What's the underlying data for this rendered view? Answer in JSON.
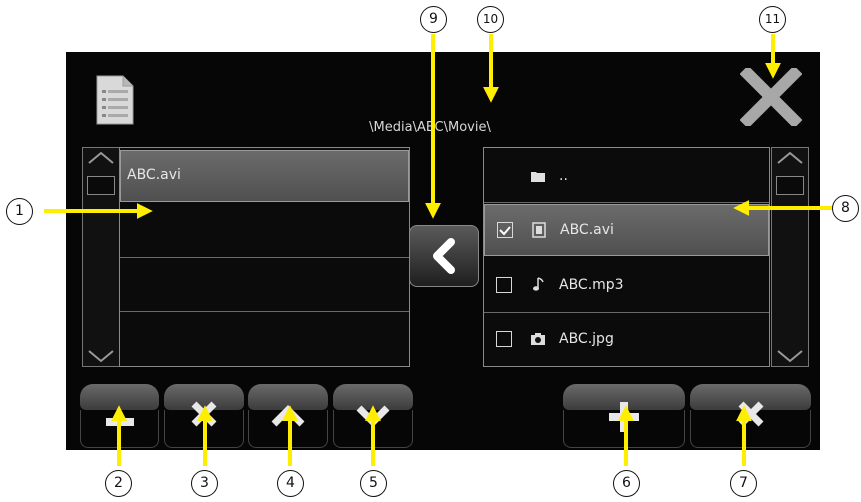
{
  "path": "\\Media\\ABC\\Movie\\",
  "playlist": {
    "items": [
      "ABC.avi",
      "",
      "",
      ""
    ]
  },
  "browser": {
    "items": [
      {
        "name": "..",
        "type": "folder",
        "checked": null
      },
      {
        "name": "ABC.avi",
        "type": "video",
        "checked": true
      },
      {
        "name": "ABC.mp3",
        "type": "audio",
        "checked": false
      },
      {
        "name": "ABC.jpg",
        "type": "image",
        "checked": false
      }
    ]
  },
  "buttons": {
    "left": [
      "minus-icon",
      "x-icon",
      "chevron-up-icon",
      "chevron-down-icon"
    ],
    "right": [
      "plus-icon",
      "x-icon"
    ]
  },
  "callouts": [
    "1",
    "2",
    "3",
    "4",
    "5",
    "6",
    "7",
    "8",
    "9",
    "10",
    "11"
  ],
  "colors": {
    "arrow": "#ffee00",
    "background": "#060606",
    "selected": "#5c5c5c"
  }
}
